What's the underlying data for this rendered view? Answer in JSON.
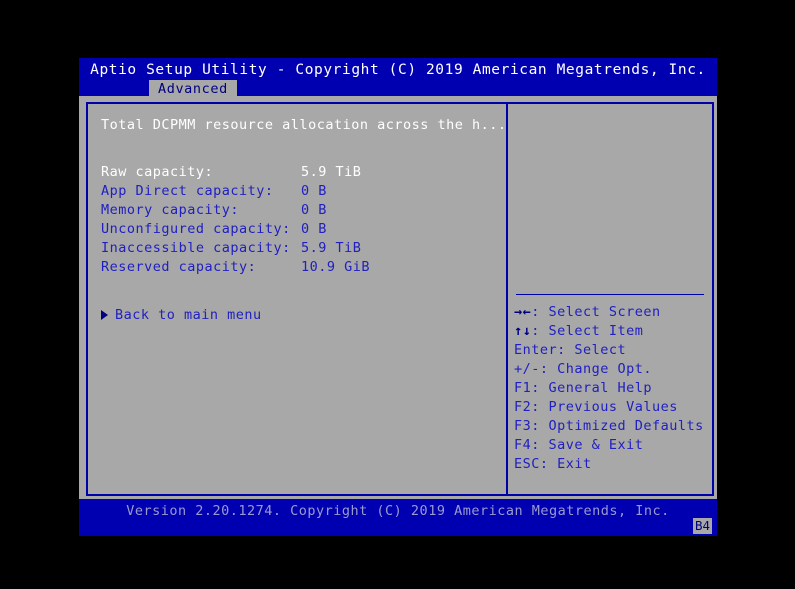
{
  "window": {
    "title": "Aptio Setup Utility - Copyright (C) 2019 American Megatrends, Inc."
  },
  "tabs": [
    {
      "label": "Advanced",
      "selected": true
    }
  ],
  "main": {
    "section_header": "Total DCPMM resource allocation across the h...",
    "capacity_rows": [
      {
        "label": "Raw capacity:",
        "value": "5.9 TiB",
        "highlighted": true
      },
      {
        "label": "App Direct capacity:",
        "value": "0 B",
        "highlighted": false
      },
      {
        "label": "Memory capacity:",
        "value": "0 B",
        "highlighted": false
      },
      {
        "label": "Unconfigured capacity:",
        "value": "0 B",
        "highlighted": false
      },
      {
        "label": "Inaccessible capacity:",
        "value": "5.9 TiB",
        "highlighted": false
      },
      {
        "label": "Reserved capacity:",
        "value": "10.9 GiB",
        "highlighted": false
      }
    ],
    "back_link": "Back to main menu"
  },
  "help": {
    "lines": [
      {
        "key": "→←",
        "text": ": Select Screen"
      },
      {
        "key": "↑↓",
        "text": ": Select Item"
      },
      {
        "key": "",
        "text": "Enter: Select"
      },
      {
        "key": "",
        "text": "+/-: Change Opt."
      },
      {
        "key": "",
        "text": "F1: General Help"
      },
      {
        "key": "",
        "text": "F2: Previous Values"
      },
      {
        "key": "",
        "text": "F3: Optimized Defaults"
      },
      {
        "key": "",
        "text": "F4: Save & Exit"
      },
      {
        "key": "",
        "text": "ESC: Exit"
      }
    ]
  },
  "footer": {
    "version_text": "Version 2.20.1274. Copyright (C) 2019 American Megatrends, Inc.",
    "badge": "B4"
  },
  "colors": {
    "screen_blue": "#0000b0",
    "panel_grey": "#a8a8a8",
    "border_blue": "#0000a8",
    "text_blue": "#2020c0",
    "text_white": "#ffffff",
    "footer_text": "#9a9ad0"
  }
}
